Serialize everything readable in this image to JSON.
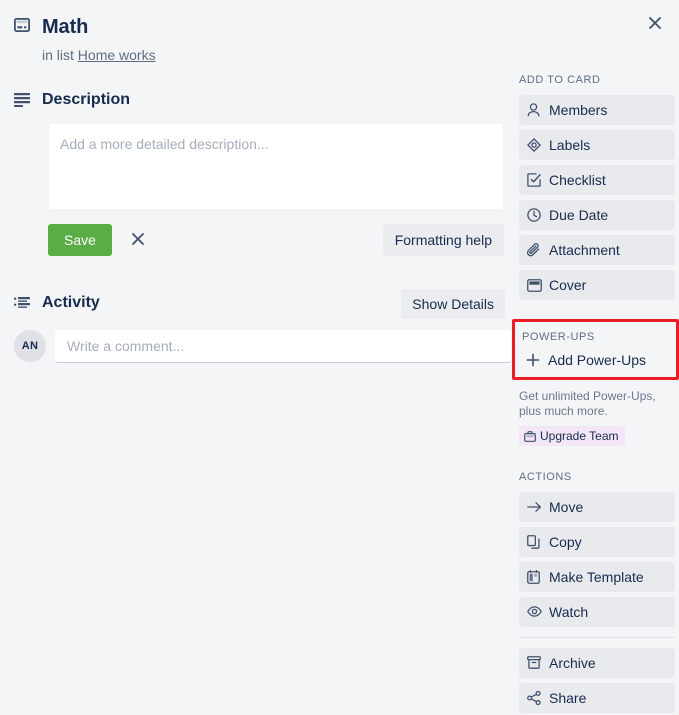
{
  "window": {
    "close_label": "×",
    "close_icon": "close-icon"
  },
  "card": {
    "icon": "card-icon",
    "title": "Math",
    "in_list_prefix": "in list",
    "list_name": "Home works"
  },
  "description": {
    "icon": "description-icon",
    "heading": "Description",
    "value": "",
    "placeholder": "Add a more detailed description...",
    "save_label": "Save",
    "cancel_icon": "close-icon",
    "formatting_help_label": "Formatting help"
  },
  "activity": {
    "icon": "activity-list-icon",
    "heading": "Activity",
    "show_details_label": "Show Details",
    "avatar_initials": "AN",
    "comment_value": "",
    "comment_placeholder": "Write a comment..."
  },
  "sidebar": {
    "add_to_card": {
      "heading": "ADD TO CARD",
      "items": [
        {
          "label": "Members",
          "icon": "member-icon"
        },
        {
          "label": "Labels",
          "icon": "label-icon"
        },
        {
          "label": "Checklist",
          "icon": "checklist-icon"
        },
        {
          "label": "Due Date",
          "icon": "clock-icon"
        },
        {
          "label": "Attachment",
          "icon": "paperclip-icon"
        },
        {
          "label": "Cover",
          "icon": "cover-icon"
        }
      ]
    },
    "power_ups": {
      "heading": "POWER-UPS",
      "add_label": "Add Power-Ups",
      "add_icon": "plus-icon",
      "highlight_color": "#ea1c25",
      "note": "Get unlimited Power-Ups, plus much more.",
      "upgrade_label": "Upgrade Team",
      "upgrade_icon": "briefcase-icon",
      "upgrade_badge_color": "#f3e7f7"
    },
    "actions": {
      "heading": "ACTIONS",
      "items_top": [
        {
          "label": "Move",
          "icon": "arrow-right-icon"
        },
        {
          "label": "Copy",
          "icon": "copy-icon"
        },
        {
          "label": "Make Template",
          "icon": "template-icon"
        },
        {
          "label": "Watch",
          "icon": "eye-icon"
        }
      ],
      "items_bottom": [
        {
          "label": "Archive",
          "icon": "archive-icon"
        },
        {
          "label": "Share",
          "icon": "share-icon"
        }
      ]
    }
  },
  "theme": {
    "background": "#f4f5f7",
    "text": "#172b4d",
    "muted_text": "#5e6c84",
    "save_green": "#5aac44",
    "button_grey": "#e9eaee"
  }
}
